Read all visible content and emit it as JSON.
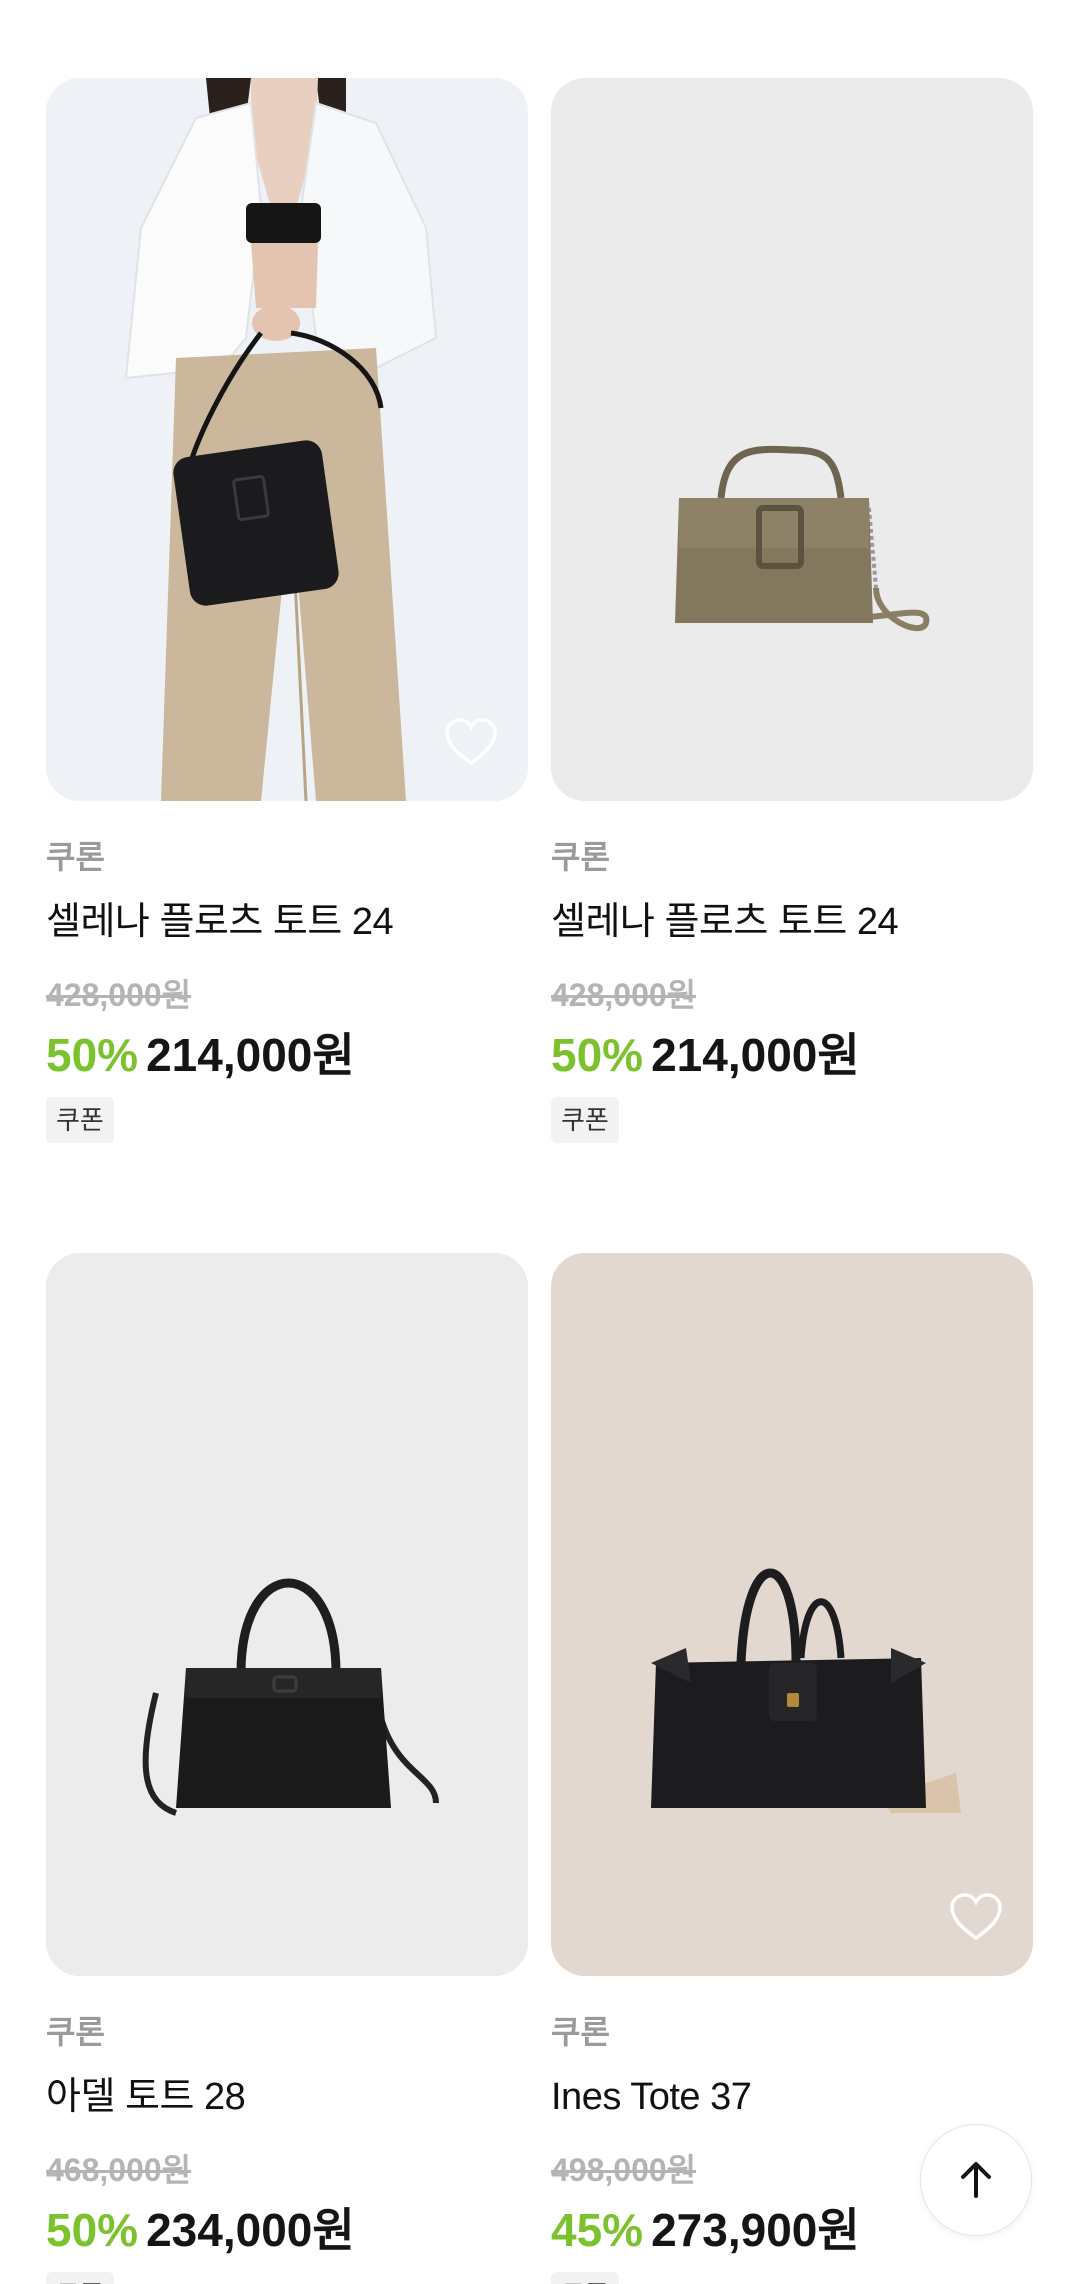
{
  "products": [
    {
      "brand": "쿠론",
      "name": "셀레나 플로츠 토트 24",
      "original_price": "428,000원",
      "discount": "50%",
      "price": "214,000원",
      "badge": "쿠폰",
      "image": "model-holding-black-bag",
      "liked": false,
      "heart_visible": true
    },
    {
      "brand": "쿠론",
      "name": "셀레나 플로츠 토트 24",
      "original_price": "428,000원",
      "discount": "50%",
      "price": "214,000원",
      "badge": "쿠폰",
      "image": "khaki-handbag",
      "liked": false,
      "heart_visible": false
    },
    {
      "brand": "쿠론",
      "name": "아델 토트 28",
      "original_price": "468,000원",
      "discount": "50%",
      "price": "234,000원",
      "badge": "쿠폰",
      "image": "black-tote-bag",
      "liked": false,
      "heart_visible": false
    },
    {
      "brand": "쿠론",
      "name": "Ines Tote 37",
      "original_price": "498,000원",
      "discount": "45%",
      "price": "273,900원",
      "badge": "쿠폰",
      "image": "black-tote-bag-beige-background",
      "liked": false,
      "heart_visible": true
    }
  ],
  "scroll_top_icon": "arrow-up-icon",
  "colors": {
    "discount": "#7cc22e",
    "price": "#151515",
    "brand": "#9a9a9a",
    "card_bg": "#ececec",
    "card_bg_beige": "#e2d8cf"
  }
}
